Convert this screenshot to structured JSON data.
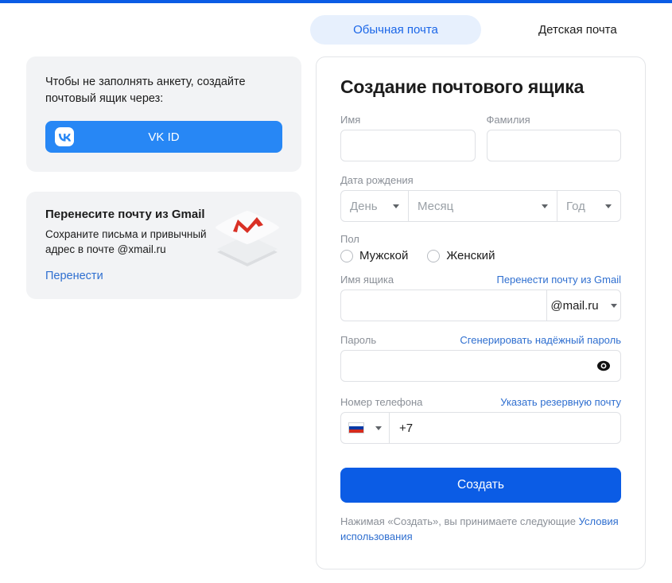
{
  "theme": {
    "accent_blue": "#0b5ce5",
    "link_blue": "#2f6fd0",
    "tab_active_bg": "#e7f0fd",
    "tab_active_text": "#1a66e8",
    "panel_bg": "#f2f3f5",
    "vk_blue": "#2787f5",
    "gmail_red": "#d93025",
    "label_grey": "#8a8f97"
  },
  "tabs": [
    {
      "label": "Обычная почта",
      "active": true
    },
    {
      "label": "Детская почта",
      "active": false
    }
  ],
  "left": {
    "vk_panel": {
      "text": "Чтобы не заполнять анкету, создайте почтовый ящик через:",
      "button_label": "VK ID",
      "icon": "vk-logo-icon"
    },
    "gmail_panel": {
      "title": "Перенесите почту из Gmail",
      "subtitle": "Сохраните письма и привычный адрес в почте @xmail.ru",
      "link": "Перенести",
      "icon": "gmail-envelope-icon"
    }
  },
  "form": {
    "title": "Создание почтового ящика",
    "first_name": {
      "label": "Имя",
      "value": "",
      "placeholder": ""
    },
    "last_name": {
      "label": "Фамилия",
      "value": "",
      "placeholder": ""
    },
    "birth_date": {
      "label": "Дата рождения",
      "day": "День",
      "month": "Месяц",
      "year": "Год"
    },
    "gender": {
      "label": "Пол",
      "options": [
        {
          "label": "Мужской",
          "selected": false
        },
        {
          "label": "Женский",
          "selected": false
        }
      ]
    },
    "mailbox": {
      "label": "Имя ящика",
      "action_link": "Перенести почту из Gmail",
      "value": "",
      "placeholder": "",
      "domain": "@mail.ru"
    },
    "password": {
      "label": "Пароль",
      "action_link": "Сгенерировать надёжный пароль",
      "value": "",
      "placeholder": "",
      "toggle_icon": "eye-icon"
    },
    "phone": {
      "label": "Номер телефона",
      "action_link": "Указать резервную почту",
      "country_icon": "russia-flag-icon",
      "value": "+7",
      "placeholder": ""
    },
    "submit_label": "Создать",
    "terms_prefix": "Нажимая «Создать», вы принимаете следующие ",
    "terms_link": "Условия использования"
  }
}
